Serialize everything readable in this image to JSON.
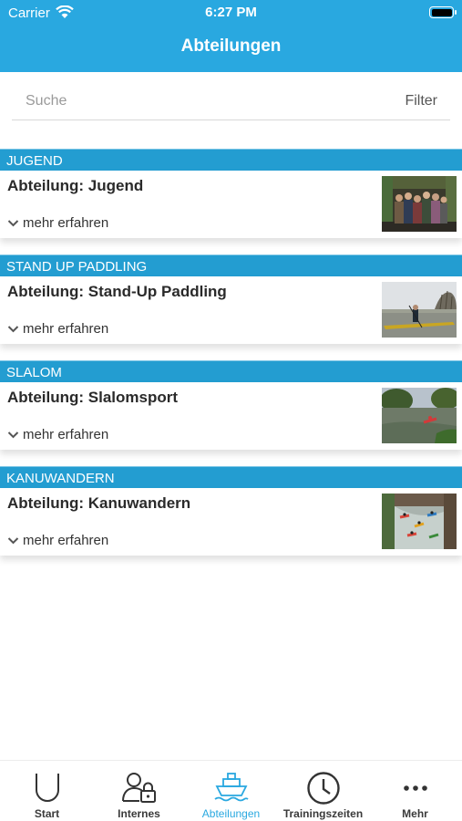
{
  "status_bar": {
    "carrier": "Carrier",
    "time": "6:27 PM"
  },
  "nav": {
    "title": "Abteilungen"
  },
  "search": {
    "placeholder": "Suche",
    "value": "",
    "filter_label": "Filter"
  },
  "sections": [
    {
      "header": "JUGEND",
      "title": "Abteilung: Jugend",
      "more": "mehr erfahren",
      "image": "group-photo"
    },
    {
      "header": "STAND UP PADDLING",
      "title": "Abteilung: Stand-Up Paddling",
      "more": "mehr erfahren",
      "image": "paddleboard-photo"
    },
    {
      "header": "SLALOM",
      "title": "Abteilung: Slalomsport",
      "more": "mehr erfahren",
      "image": "river-slalom-photo"
    },
    {
      "header": "KANUWANDERN",
      "title": "Abteilung: Kanuwandern",
      "more": "mehr erfahren",
      "image": "canoe-tour-photo"
    }
  ],
  "tabbar": {
    "tabs": [
      {
        "label": "Start",
        "icon": "horseshoe-icon",
        "active": false
      },
      {
        "label": "Internes",
        "icon": "user-lock-icon",
        "active": false
      },
      {
        "label": "Abteilungen",
        "icon": "ship-icon",
        "active": true
      },
      {
        "label": "Trainingszeiten",
        "icon": "clock-icon",
        "active": false
      },
      {
        "label": "Mehr",
        "icon": "more-dots-icon",
        "active": false
      }
    ]
  },
  "colors": {
    "accent": "#29a8e0",
    "section_header": "#239dd1",
    "text": "#222222"
  }
}
